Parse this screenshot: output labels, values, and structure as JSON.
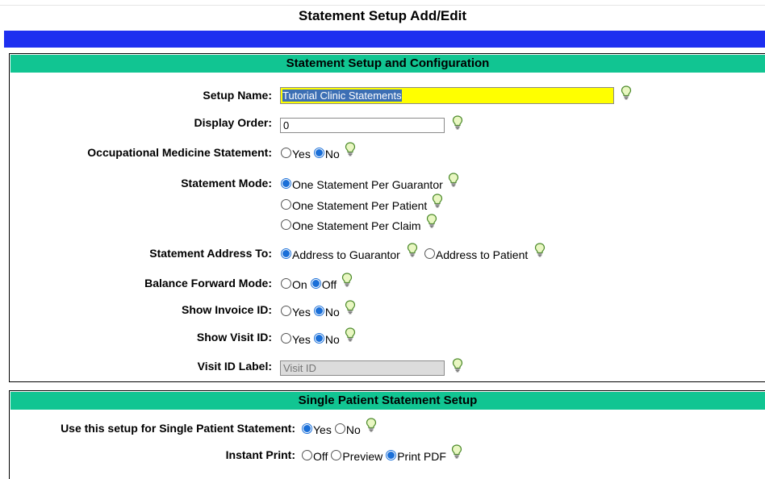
{
  "page": {
    "title": "Statement Setup Add/Edit"
  },
  "section1": {
    "title": "Statement Setup and Configuration",
    "setup_name": {
      "label": "Setup Name:",
      "value": "Tutorial Clinic Statements",
      "highlight": "#ffff00"
    },
    "display_order": {
      "label": "Display Order:",
      "value": "0"
    },
    "occ_med": {
      "label": "Occupational Medicine Statement:",
      "yes": "Yes",
      "no": "No",
      "selected": "No"
    },
    "statement_mode": {
      "label": "Statement Mode:",
      "options": [
        "One Statement Per Guarantor",
        "One Statement Per Patient",
        "One Statement Per Claim"
      ],
      "selected": "One Statement Per Guarantor"
    },
    "address_to": {
      "label": "Statement Address To:",
      "options": [
        "Address to Guarantor",
        "Address to Patient"
      ],
      "selected": "Address to Guarantor"
    },
    "balance_forward": {
      "label": "Balance Forward Mode:",
      "on": "On",
      "off": "Off",
      "selected": "Off"
    },
    "show_invoice": {
      "label": "Show Invoice ID:",
      "yes": "Yes",
      "no": "No",
      "selected": "No"
    },
    "show_visit": {
      "label": "Show Visit ID:",
      "yes": "Yes",
      "no": "No",
      "selected": "No"
    },
    "visit_label": {
      "label": "Visit ID Label:",
      "placeholder": "Visit ID"
    }
  },
  "section2": {
    "title": "Single Patient Statement Setup",
    "use_setup": {
      "label": "Use this setup for Single Patient Statement:",
      "yes": "Yes",
      "no": "No",
      "selected": "Yes"
    },
    "instant_print": {
      "label": "Instant Print:",
      "options": [
        "Off",
        "Preview",
        "Print PDF"
      ],
      "selected": "Print PDF"
    }
  },
  "colors": {
    "header_bar": "#1d2ff0",
    "section_header": "#11c592",
    "radio_selected": "#1a6fd8"
  },
  "icons": {
    "help": "lightbulb-icon"
  }
}
